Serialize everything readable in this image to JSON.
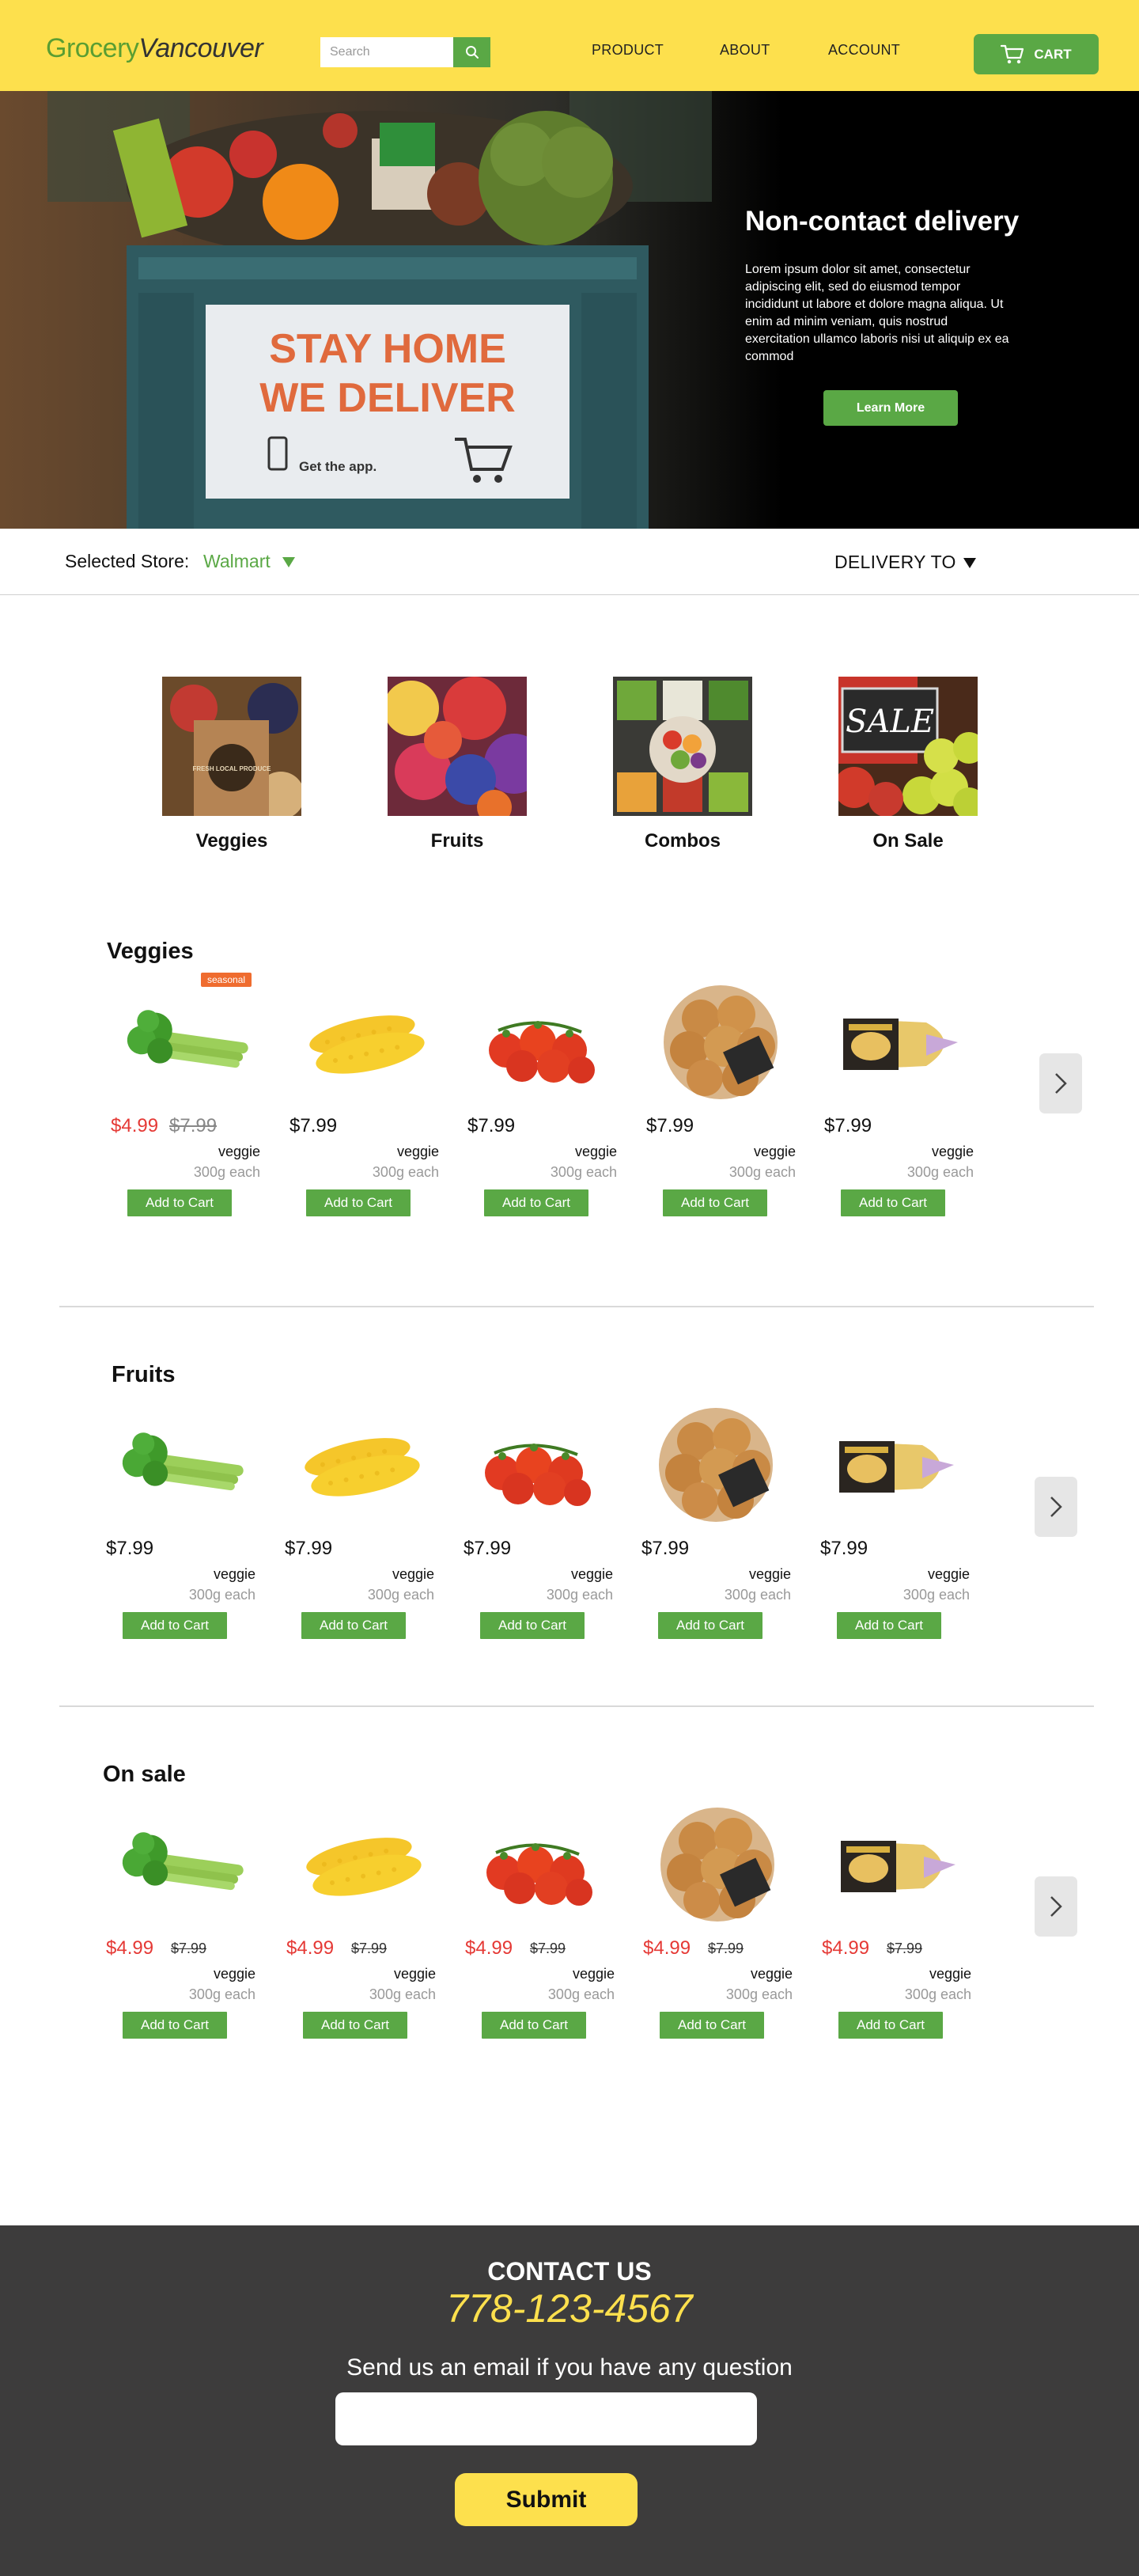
{
  "header": {
    "logo_part1": "Grocery",
    "logo_part2": "Vancouver",
    "search_placeholder": "Search",
    "nav": [
      "PRODUCT",
      "ABOUT",
      "ACCOUNT"
    ],
    "cart_label": "CART"
  },
  "hero": {
    "title": "Non-contact delivery",
    "body": "Lorem ipsum dolor sit amet, consectetur adipiscing elit, sed do eiusmod tempor incididunt ut labore et dolore magna aliqua. Ut enim ad minim veniam, quis nostrud exercitation ullamco laboris nisi ut aliquip ex ea commod",
    "button": "Learn More",
    "image_text": {
      "line1": "STAY HOME",
      "line2": "WE DELIVER",
      "app": "Get the app."
    }
  },
  "store_bar": {
    "label": "Selected Store:",
    "store": "Walmart",
    "delivery": "DELIVERY TO"
  },
  "categories": [
    {
      "label": "Veggies"
    },
    {
      "label": "Fruits"
    },
    {
      "label": "Combos"
    },
    {
      "label": "On Sale"
    }
  ],
  "category_image_text": {
    "veggies_bag": "FRESH LOCAL PRODUCE",
    "sale_sign": "SALE"
  },
  "sections": [
    {
      "title": "Veggies",
      "badge": "seasonal",
      "products": [
        {
          "name": "celery",
          "price": "$4.99",
          "old_price": "$7.99",
          "type": "veggie",
          "weight": "300g each",
          "button": "Add to Cart"
        },
        {
          "name": "corn",
          "price": "$7.99",
          "type": "veggie",
          "weight": "300g each",
          "button": "Add to Cart"
        },
        {
          "name": "tomatoes",
          "price": "$7.99",
          "type": "veggie",
          "weight": "300g each",
          "button": "Add to Cart"
        },
        {
          "name": "onions",
          "price": "$7.99",
          "type": "veggie",
          "weight": "300g each",
          "button": "Add to Cart"
        },
        {
          "name": "potatoes",
          "price": "$7.99",
          "type": "veggie",
          "weight": "300g each",
          "button": "Add to Cart"
        }
      ]
    },
    {
      "title": "Fruits",
      "products": [
        {
          "name": "celery",
          "price": "$7.99",
          "type": "veggie",
          "weight": "300g each",
          "button": "Add to Cart"
        },
        {
          "name": "corn",
          "price": "$7.99",
          "type": "veggie",
          "weight": "300g each",
          "button": "Add to Cart"
        },
        {
          "name": "tomatoes",
          "price": "$7.99",
          "type": "veggie",
          "weight": "300g each",
          "button": "Add to Cart"
        },
        {
          "name": "onions",
          "price": "$7.99",
          "type": "veggie",
          "weight": "300g each",
          "button": "Add to Cart"
        },
        {
          "name": "potatoes",
          "price": "$7.99",
          "type": "veggie",
          "weight": "300g each",
          "button": "Add to Cart"
        }
      ]
    },
    {
      "title": "On sale",
      "products": [
        {
          "name": "celery",
          "price": "$4.99",
          "old_price": "$7.99",
          "type": "veggie",
          "weight": "300g each",
          "button": "Add to Cart"
        },
        {
          "name": "corn",
          "price": "$4.99",
          "old_price": "$7.99",
          "type": "veggie",
          "weight": "300g each",
          "button": "Add to Cart"
        },
        {
          "name": "tomatoes",
          "price": "$4.99",
          "old_price": "$7.99",
          "type": "veggie",
          "weight": "300g each",
          "button": "Add to Cart"
        },
        {
          "name": "onions",
          "price": "$4.99",
          "old_price": "$7.99",
          "type": "veggie",
          "weight": "300g each",
          "button": "Add to Cart"
        },
        {
          "name": "potatoes",
          "price": "$4.99",
          "old_price": "$7.99",
          "type": "veggie",
          "weight": "300g each",
          "button": "Add to Cart"
        }
      ]
    }
  ],
  "footer": {
    "title": "CONTACT US",
    "phone": "778-123-4567",
    "note": "Send us an email if you have any question",
    "email_value": "",
    "submit": "Submit"
  },
  "colors": {
    "brand_yellow": "#fde04d",
    "brand_green": "#5aa845",
    "sale_red": "#e53935",
    "badge_orange": "#ef6c2f",
    "footer_bg": "#3d3c3c"
  },
  "icons": [
    "search-icon",
    "cart-icon",
    "dropdown-caret-icon",
    "chevron-right-icon"
  ]
}
